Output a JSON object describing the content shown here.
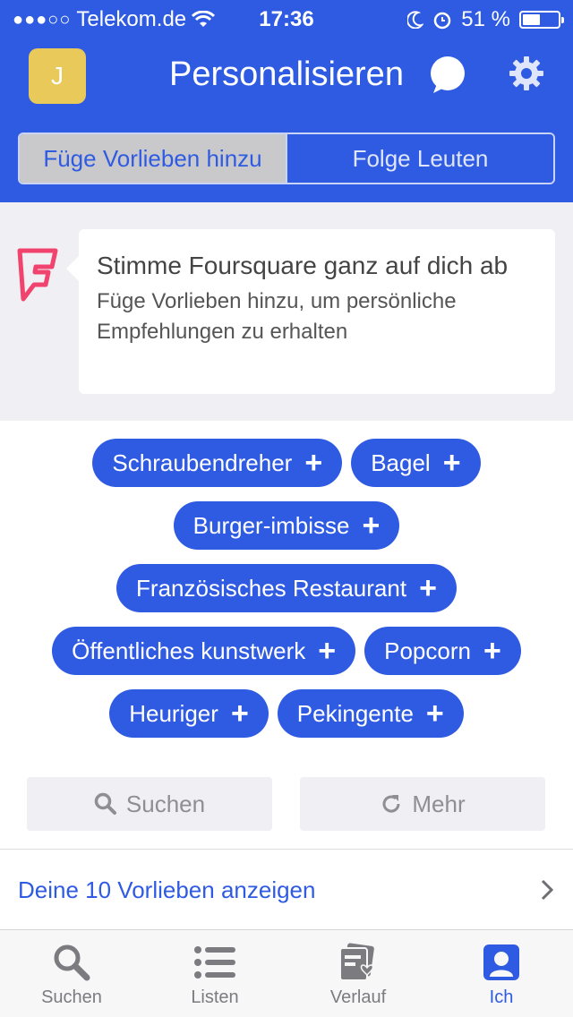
{
  "status_bar": {
    "signal": "●●●○○",
    "carrier": "Telekom.de",
    "time": "17:36",
    "battery_percent": "51 %",
    "battery_level": 0.51
  },
  "nav": {
    "avatar_initial": "J",
    "title": "Personalisieren"
  },
  "segments": {
    "active_label": "Füge Vorlieben hinzu",
    "inactive_label": "Folge Leuten"
  },
  "banner": {
    "title": "Stimme Foursquare ganz auf dich ab",
    "text": "Füge Vorlieben hinzu, um persönliche Empfehlungen zu erhalten"
  },
  "chips": [
    [
      "Schraubendreher",
      "Bagel"
    ],
    [
      "Burger-imbisse"
    ],
    [
      "Französisches Restaurant"
    ],
    [
      "Öffentliches kunstwerk",
      "Popcorn"
    ],
    [
      "Heuriger",
      "Pekingente"
    ]
  ],
  "actions": {
    "search_label": "Suchen",
    "more_label": "Mehr"
  },
  "likes_link": "Deine 10 Vorlieben anzeigen",
  "tabs": [
    {
      "label": "Suchen",
      "icon": "search-icon",
      "active": false
    },
    {
      "label": "Listen",
      "icon": "list-icon",
      "active": false
    },
    {
      "label": "Verlauf",
      "icon": "history-icon",
      "active": false
    },
    {
      "label": "Ich",
      "icon": "profile-icon",
      "active": true
    }
  ],
  "colors": {
    "primary": "#2f5be2",
    "avatar": "#e8c95a",
    "foursquare_logo": "#f0436e"
  }
}
